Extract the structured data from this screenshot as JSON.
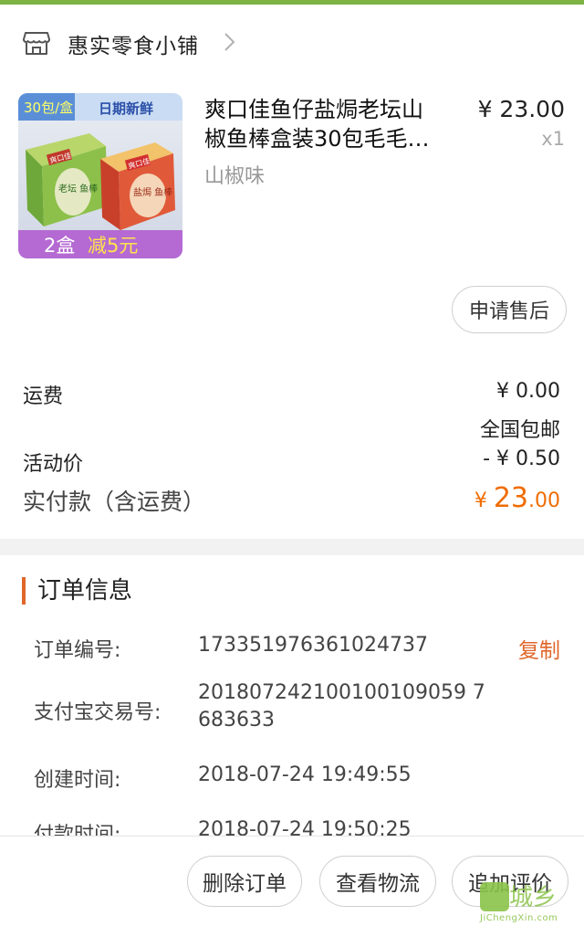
{
  "colors": {
    "accent_orange": "#ef6c00",
    "accent_green": "#7cb342",
    "section_bar": "#e0672a"
  },
  "shop": {
    "name": "惠实零食小铺",
    "icon": "store-icon"
  },
  "product": {
    "title_line1": "爽口佳鱼仔盐焗老坛山",
    "title_line2": "椒鱼棒盒装30包毛毛…",
    "spec": "山椒味",
    "price": "¥ 23.00",
    "quantity": "x1",
    "image": {
      "banner_left": "30包/盒",
      "banner_right": "日期新鲜",
      "brand_left": "爽口佳",
      "brand_right": "爽口佳",
      "box_left_text": "老坛 鱼棒",
      "box_right_text": "盐焗 鱼棒",
      "promo_prefix": "2盒",
      "promo_highlight": "减5元"
    }
  },
  "after_sale_button": "申请售后",
  "fees": {
    "shipping_label": "运费",
    "shipping_value": "¥ 0.00",
    "shipping_note": "全国包邮",
    "discount_label": "活动价",
    "discount_value": "- ¥ 0.50",
    "paid_label": "实付款（含运费）",
    "paid_currency": "¥ ",
    "paid_int": "23",
    "paid_dec": ".00"
  },
  "order_info": {
    "title": "订单信息",
    "copy_label": "复制",
    "rows": [
      {
        "label": "订单编号:",
        "value": "173351976361024737"
      },
      {
        "label": "支付宝交易号:",
        "value_line1": "201807242100100109059 7",
        "value_line2": "683633"
      },
      {
        "label": "创建时间:",
        "value": "2018-07-24 19:49:55"
      },
      {
        "label": "付款时间:",
        "value": "2018-07-24 19:50:25"
      }
    ]
  },
  "actions": {
    "delete": "删除订单",
    "logistics": "查看物流",
    "review": "追加评价"
  },
  "watermark": {
    "text": "城乡",
    "url": "JiChengXin.com"
  }
}
